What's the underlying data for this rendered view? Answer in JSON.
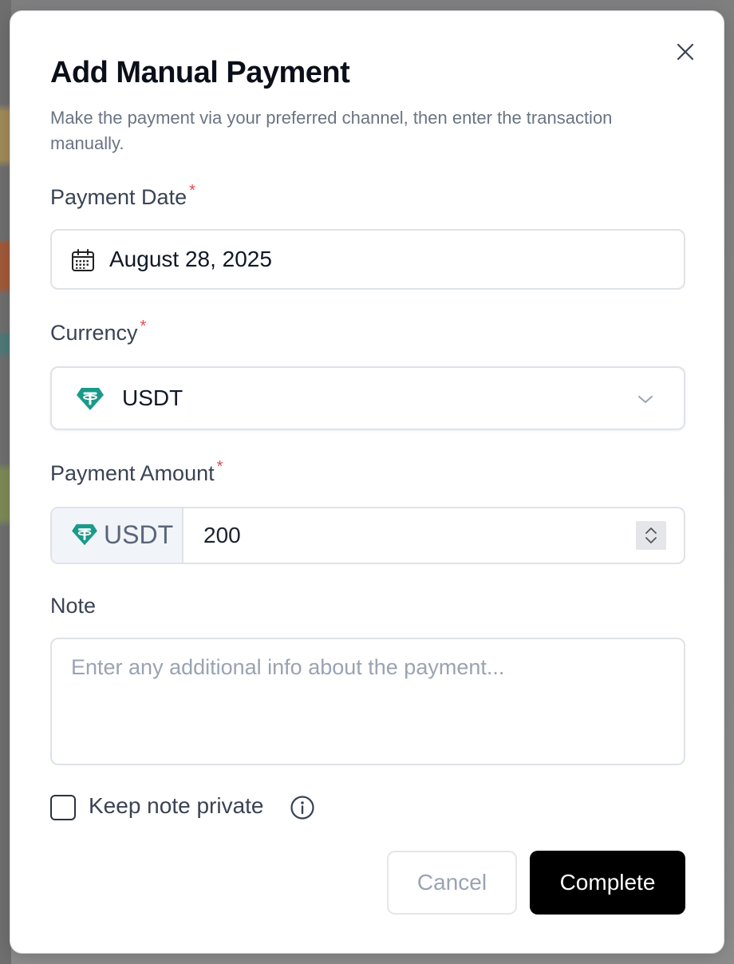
{
  "modal": {
    "title": "Add Manual Payment",
    "subtitle": "Make the payment via your preferred channel, then enter the transaction manually.",
    "close_icon": "close-icon"
  },
  "form": {
    "payment_date": {
      "label": "Payment Date",
      "required_mark": "*",
      "value": "August 28, 2025",
      "icon": "calendar-icon"
    },
    "currency": {
      "label": "Currency",
      "required_mark": "*",
      "value": "USDT",
      "icon": "tether-icon",
      "chevron_icon": "chevron-down-icon"
    },
    "payment_amount": {
      "label": "Payment Amount",
      "required_mark": "*",
      "prefix": "USDT",
      "value": "200",
      "icon": "tether-icon"
    },
    "note": {
      "label": "Note",
      "placeholder": "Enter any additional info about the payment..."
    },
    "keep_private": {
      "label": "Keep note private",
      "checked": false,
      "icon": "info-icon"
    }
  },
  "actions": {
    "cancel_label": "Cancel",
    "complete_label": "Complete"
  },
  "colors": {
    "tether": "#1a9a8a",
    "required": "#e5484d",
    "primary_button": "#000000"
  }
}
